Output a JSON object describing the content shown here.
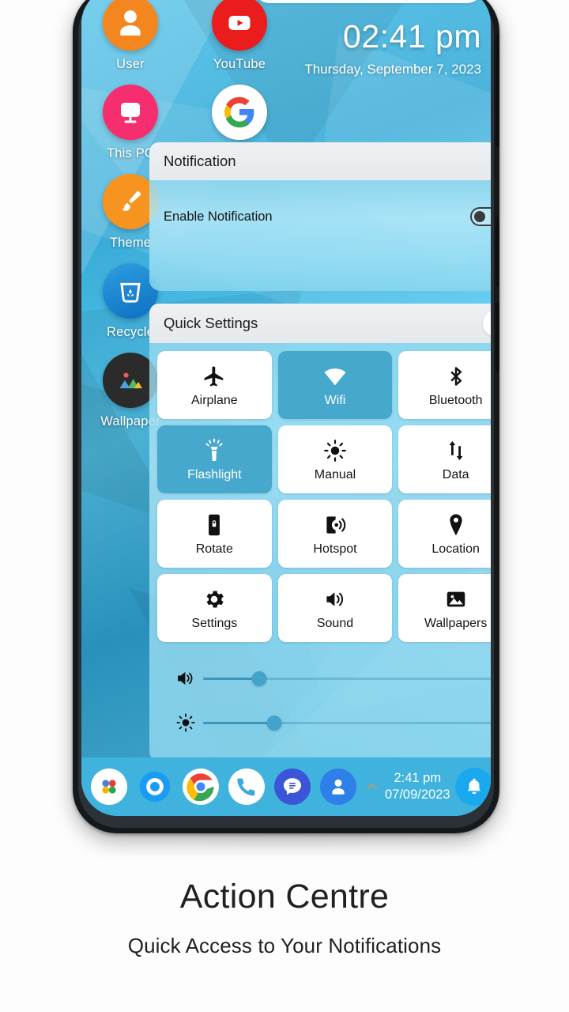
{
  "phone": {
    "wallpaper_theme": "blue-low-poly",
    "accent_color": "#3fb3dd",
    "active_tile_color": "#46a8cc"
  },
  "home": {
    "clock": {
      "time": "02:41 pm",
      "date": "Thursday, September 7, 2023"
    },
    "desktop_icons": [
      {
        "label": "User",
        "icon": "user-icon"
      },
      {
        "label": "YouTube",
        "icon": "youtube-icon"
      },
      {
        "label": "This PC",
        "icon": "this-pc-icon"
      },
      {
        "label": "Google",
        "icon": "google-icon"
      },
      {
        "label": "Theme",
        "icon": "theme-brush-icon"
      },
      {
        "label": "Recycle",
        "icon": "recycle-bin-icon"
      },
      {
        "label": "Wallpaper",
        "icon": "wallpaper-image-icon"
      }
    ]
  },
  "notification_panel": {
    "title": "Notification",
    "enable_label": "Enable Notification",
    "enable_value": "off"
  },
  "quick_settings": {
    "title": "Quick Settings",
    "collapse_icon": "chevron-down-icon",
    "tiles": [
      {
        "label": "Airplane",
        "icon": "airplane-icon",
        "active": false
      },
      {
        "label": "Wifi",
        "icon": "wifi-icon",
        "active": true
      },
      {
        "label": "Bluetooth",
        "icon": "bluetooth-icon",
        "active": false
      },
      {
        "label": "Flashlight",
        "icon": "flashlight-icon",
        "active": true
      },
      {
        "label": "Manual",
        "icon": "brightness-icon",
        "active": false
      },
      {
        "label": "Data",
        "icon": "data-arrows-icon",
        "active": false
      },
      {
        "label": "Rotate",
        "icon": "rotate-lock-icon",
        "active": false
      },
      {
        "label": "Hotspot",
        "icon": "hotspot-icon",
        "active": false
      },
      {
        "label": "Location",
        "icon": "location-pin-icon",
        "active": false
      },
      {
        "label": "Settings",
        "icon": "gear-icon",
        "active": false
      },
      {
        "label": "Sound",
        "icon": "speaker-icon",
        "active": false
      },
      {
        "label": "Wallpapers",
        "icon": "image-icon",
        "active": false
      }
    ],
    "sliders": [
      {
        "name": "volume",
        "icon": "speaker-icon",
        "value": 19
      },
      {
        "name": "brightness",
        "icon": "brightness-icon",
        "value": 24
      }
    ]
  },
  "taskbar": {
    "icons": [
      {
        "name": "app-launcher-icon"
      },
      {
        "name": "assistant-icon"
      },
      {
        "name": "chrome-icon"
      },
      {
        "name": "phone-icon"
      },
      {
        "name": "messages-icon"
      },
      {
        "name": "user-account-icon"
      }
    ],
    "expand_icon": "chevron-up-icon",
    "time": "2:41 pm",
    "date": "07/09/2023",
    "notification_icon": "bell-icon"
  },
  "caption": {
    "title": "Action Centre",
    "subtitle": "Quick Access to Your Notifications"
  }
}
